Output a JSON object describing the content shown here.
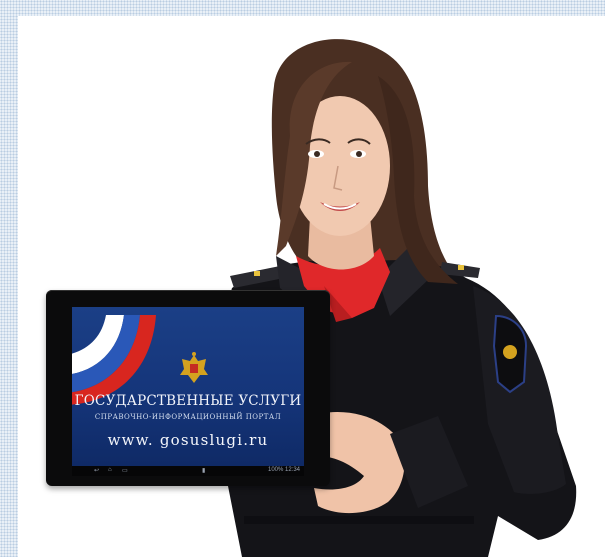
{
  "tablet": {
    "title": "ГОСУДАРСТВЕННЫЕ УСЛУГИ",
    "subtitle": "СПРАВОЧНО-ИНФОРМАЦИОННЫЙ ПОРТАЛ",
    "url": "www. gosuslugi.ru",
    "status": {
      "battery": "100%",
      "time": "12:34"
    }
  },
  "colors": {
    "screen": "#1b3f86",
    "uniform": "#141418",
    "scarf": "#e0282a",
    "hair": "#4a2f22",
    "skin": "#f1c9b0",
    "flag_red": "#d8261f",
    "flag_blue": "#2a58b8"
  }
}
